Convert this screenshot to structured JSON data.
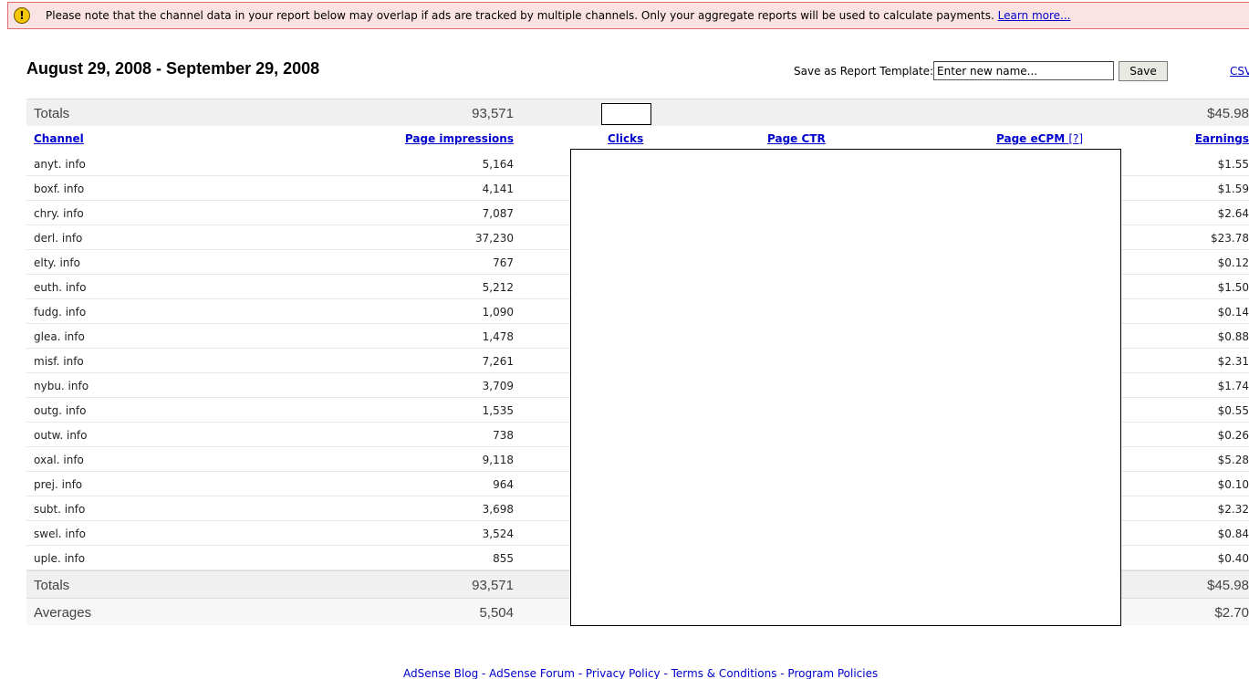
{
  "notice": {
    "icon": "warning-icon",
    "text": "Please note that the channel data in your report below may overlap if ads are tracked by multiple channels. Only your aggregate reports will be used to calculate payments.",
    "link": "Learn more..."
  },
  "header": {
    "date_range": "August 29, 2008 - September 29, 2008",
    "template_label": "Save as Report Template:",
    "template_placeholder": "Enter new name...",
    "save_label": "Save",
    "csv_label": "CSV"
  },
  "table": {
    "top_totals": {
      "label": "Totals",
      "impressions": "93,571",
      "earnings": "$45.98"
    },
    "columns": {
      "channel": "Channel",
      "impressions": "Page impressions",
      "clicks": "Clicks",
      "ctr": "Page CTR",
      "ecpm": "Page eCPM",
      "ecpm_help": "[?]",
      "earnings": "Earnings"
    },
    "rows": [
      {
        "channel": "anyt. info",
        "impressions": "5,164",
        "earnings": "$1.55"
      },
      {
        "channel": "boxf. info",
        "impressions": "4,141",
        "earnings": "$1.59"
      },
      {
        "channel": "chry. info",
        "impressions": "7,087",
        "earnings": "$2.64"
      },
      {
        "channel": "derl. info",
        "impressions": "37,230",
        "earnings": "$23.78"
      },
      {
        "channel": "elty. info",
        "impressions": "767",
        "earnings": "$0.12"
      },
      {
        "channel": "euth. info",
        "impressions": "5,212",
        "earnings": "$1.50"
      },
      {
        "channel": "fudg. info",
        "impressions": "1,090",
        "earnings": "$0.14"
      },
      {
        "channel": "glea. info",
        "impressions": "1,478",
        "earnings": "$0.88"
      },
      {
        "channel": "misf. info",
        "impressions": "7,261",
        "earnings": "$2.31"
      },
      {
        "channel": "nybu. info",
        "impressions": "3,709",
        "earnings": "$1.74"
      },
      {
        "channel": "outg. info",
        "impressions": "1,535",
        "earnings": "$0.55"
      },
      {
        "channel": "outw. info",
        "impressions": "738",
        "earnings": "$0.26"
      },
      {
        "channel": "oxal. info",
        "impressions": "9,118",
        "earnings": "$5.28"
      },
      {
        "channel": "prej. info",
        "impressions": "964",
        "earnings": "$0.10"
      },
      {
        "channel": "subt. info",
        "impressions": "3,698",
        "earnings": "$2.32"
      },
      {
        "channel": "swel. info",
        "impressions": "3,524",
        "earnings": "$0.84"
      },
      {
        "channel": "uple. info",
        "impressions": "855",
        "earnings": "$0.40"
      }
    ],
    "bottom_totals": {
      "label": "Totals",
      "impressions": "93,571",
      "earnings": "$45.98"
    },
    "averages": {
      "label": "Averages",
      "impressions": "5,504",
      "earnings": "$2.70"
    }
  },
  "footer": {
    "links": [
      "AdSense Blog",
      "AdSense Forum",
      "Privacy Policy",
      "Terms & Conditions",
      "Program Policies"
    ],
    "separator": " - "
  }
}
